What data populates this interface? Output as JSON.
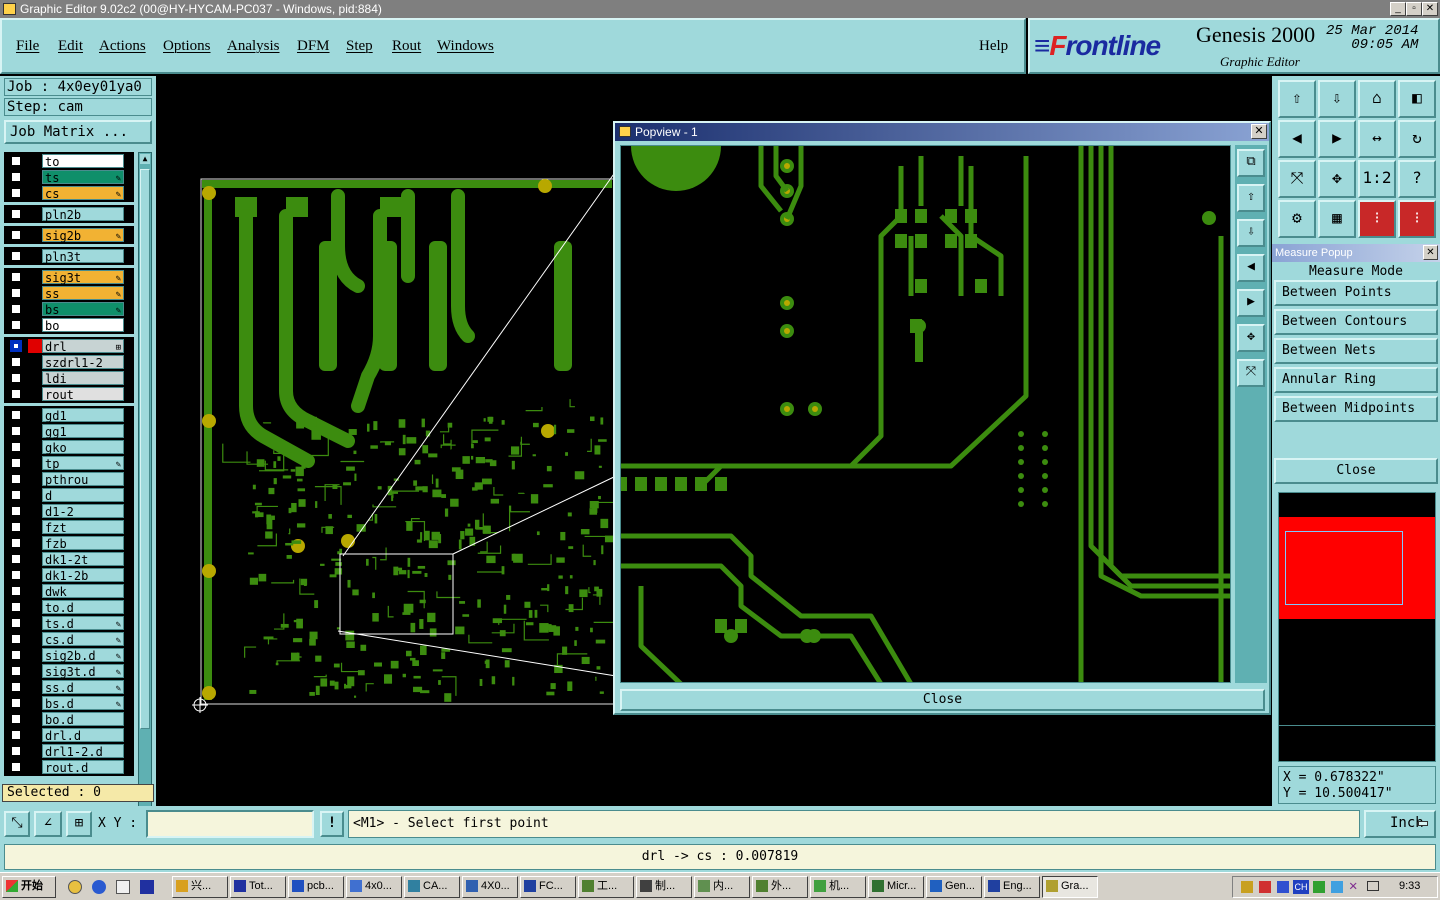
{
  "window": {
    "title": "Graphic Editor 9.02c2 (00@HY-HYCAM-PC037 - Windows, pid:884)"
  },
  "menu": {
    "items": [
      "File",
      "Edit",
      "Actions",
      "Options",
      "Analysis",
      "DFM",
      "Step",
      "Rout",
      "Windows"
    ],
    "help": "Help"
  },
  "brand": {
    "logo_prefix": "F",
    "logo_rest": "rontline",
    "product": "Genesis 2000",
    "subtitle": "Graphic Editor",
    "date": "25 Mar 2014",
    "time": "09:05 AM"
  },
  "job": {
    "job_line": "Job : 4x0ey01ya0",
    "step_line": "Step: cam",
    "matrix_button": "Job Matrix ..."
  },
  "layers": [
    {
      "name": "to",
      "color": "#ffffff",
      "mark": ""
    },
    {
      "name": "ts",
      "color": "#0f8f6a",
      "mark": "✎"
    },
    {
      "name": "cs",
      "color": "#f2b233",
      "mark": "✎"
    },
    {
      "name": "pln2b",
      "color": "#9fd9db",
      "mark": ""
    },
    {
      "name": "sig2b",
      "color": "#f2b233",
      "mark": "✎"
    },
    {
      "name": "pln3t",
      "color": "#9fd9db",
      "mark": ""
    },
    {
      "name": "sig3t",
      "color": "#f2b233",
      "mark": "✎"
    },
    {
      "name": "ss",
      "color": "#f2b233",
      "mark": "✎"
    },
    {
      "name": "bs",
      "color": "#0f8f6a",
      "mark": "✎"
    },
    {
      "name": "bo",
      "color": "#ffffff",
      "mark": ""
    },
    {
      "name": "drl",
      "color": "#c7d3d3",
      "mark": "⊞"
    },
    {
      "name": "szdrl1-2",
      "color": "#c7d3d3",
      "mark": ""
    },
    {
      "name": "ldi",
      "color": "#c7d3d3",
      "mark": ""
    },
    {
      "name": "rout",
      "color": "#e0e0e0",
      "mark": ""
    },
    {
      "name": "gd1",
      "color": "#9fd9db",
      "mark": ""
    },
    {
      "name": "gg1",
      "color": "#9fd9db",
      "mark": ""
    },
    {
      "name": "gko",
      "color": "#9fd9db",
      "mark": ""
    },
    {
      "name": "tp",
      "color": "#9fd9db",
      "mark": "✎"
    },
    {
      "name": "pthrou",
      "color": "#9fd9db",
      "mark": ""
    },
    {
      "name": "d",
      "color": "#9fd9db",
      "mark": ""
    },
    {
      "name": "d1-2",
      "color": "#9fd9db",
      "mark": ""
    },
    {
      "name": "fzt",
      "color": "#9fd9db",
      "mark": ""
    },
    {
      "name": "fzb",
      "color": "#9fd9db",
      "mark": ""
    },
    {
      "name": "dk1-2t",
      "color": "#9fd9db",
      "mark": ""
    },
    {
      "name": "dk1-2b",
      "color": "#9fd9db",
      "mark": ""
    },
    {
      "name": "dwk",
      "color": "#9fd9db",
      "mark": ""
    },
    {
      "name": "to.d",
      "color": "#9fd9db",
      "mark": ""
    },
    {
      "name": "ts.d",
      "color": "#9fd9db",
      "mark": "✎"
    },
    {
      "name": "cs.d",
      "color": "#9fd9db",
      "mark": "✎"
    },
    {
      "name": "sig2b.d",
      "color": "#9fd9db",
      "mark": "✎"
    },
    {
      "name": "sig3t.d",
      "color": "#9fd9db",
      "mark": "✎"
    },
    {
      "name": "ss.d",
      "color": "#9fd9db",
      "mark": "✎"
    },
    {
      "name": "bs.d",
      "color": "#9fd9db",
      "mark": "✎"
    },
    {
      "name": "bo.d",
      "color": "#9fd9db",
      "mark": ""
    },
    {
      "name": "drl.d",
      "color": "#9fd9db",
      "mark": ""
    },
    {
      "name": "drl1-2.d",
      "color": "#9fd9db",
      "mark": ""
    },
    {
      "name": "rout.d",
      "color": "#9fd9db",
      "mark": ""
    }
  ],
  "selected": "Selected : 0",
  "popview": {
    "title": "Popview - 1",
    "close": "Close"
  },
  "measure": {
    "title": "Measure Popup",
    "mode_label": "Measure Mode",
    "options": [
      "Between Points",
      "Between Contours",
      "Between Nets",
      "Annular Ring",
      "Between Midpoints"
    ],
    "close": "Close"
  },
  "coords": {
    "x": "X = 0.678322\"",
    "y": "Y = 10.500417\""
  },
  "command": {
    "xy_label": "X Y :",
    "xy_value": "",
    "prompt": "<M1> - Select first point",
    "units": "Inch"
  },
  "status": {
    "text": "drl -> cs : 0.007819"
  },
  "taskbar": {
    "start": "开始",
    "items": [
      "兴...",
      "Tot...",
      "pcb...",
      "4x0...",
      "CA...",
      "4X0...",
      "FC...",
      "工...",
      "制...",
      "内...",
      "外...",
      "机...",
      "Micr...",
      "Gen...",
      "Eng...",
      "Gra..."
    ],
    "tray_ch": "CH",
    "clock": "9:33"
  },
  "colors": {
    "trace": "#3c8c0f",
    "pad": "#b8a800",
    "panel": "#9fd9db",
    "measure_red": "#ff0000"
  }
}
